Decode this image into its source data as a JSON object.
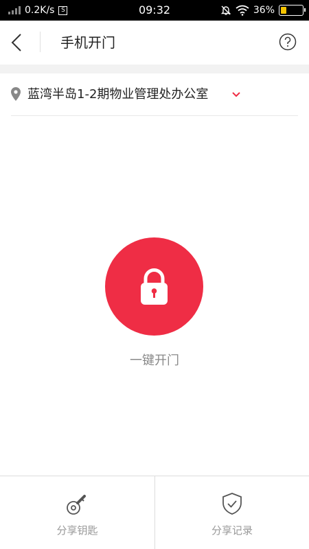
{
  "status_bar": {
    "speed": "0.2K/s",
    "s_badge": "S",
    "time": "09:32",
    "battery": "36%",
    "battery_level": 0.36,
    "icons": [
      "signal-icon",
      "silent-bell-icon",
      "wifi-icon",
      "battery-icon"
    ]
  },
  "header": {
    "title": "手机开门",
    "back_icon": "chevron-left-icon",
    "help_icon": "question-circle-icon"
  },
  "location": {
    "name": "蓝湾半岛1-2期物业管理处办公室",
    "pin_icon": "location-pin-icon",
    "dropdown_icon": "chevron-down-icon"
  },
  "unlock": {
    "label": "一键开门",
    "icon": "padlock-icon"
  },
  "bottom_tabs": [
    {
      "label": "分享钥匙",
      "icon": "key-icon"
    },
    {
      "label": "分享记录",
      "icon": "shield-check-icon"
    }
  ],
  "colors": {
    "accent": "#ef2d45",
    "battery_fill": "#f5c400",
    "muted_text": "#888888"
  }
}
